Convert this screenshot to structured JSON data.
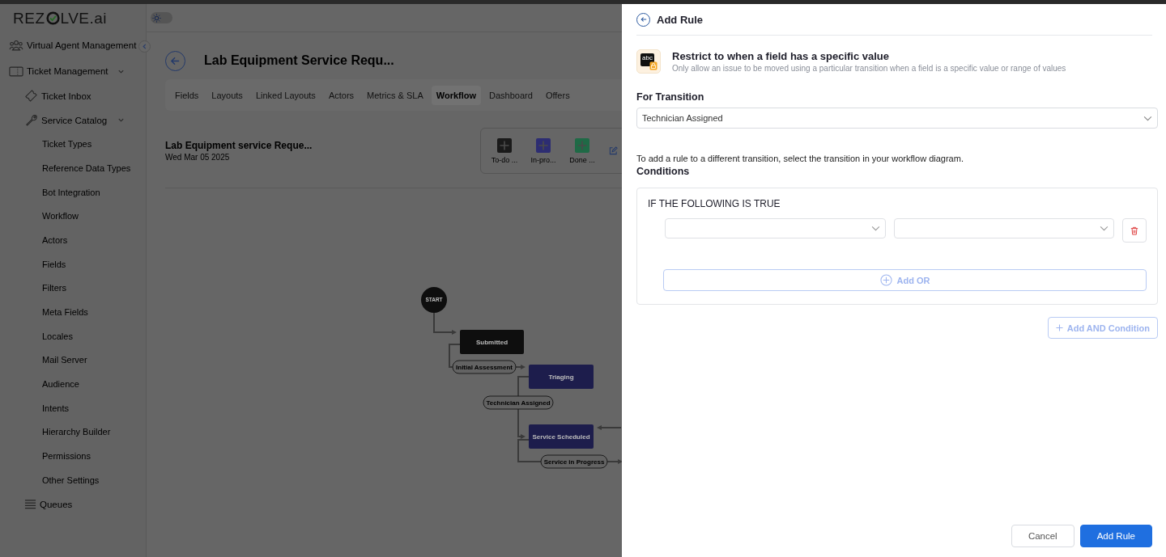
{
  "logo": {
    "start": "REZ",
    "end": "LVE.ai"
  },
  "sidebar": {
    "items": [
      {
        "label": "Virtual Agent Management"
      },
      {
        "label": "Ticket Management",
        "expanded": true,
        "children": [
          {
            "label": "Ticket Inbox"
          },
          {
            "label": "Service Catalog",
            "expanded": true,
            "children": [
              {
                "label": "Ticket Types"
              },
              {
                "label": "Reference Data Types"
              },
              {
                "label": "Bot Integration"
              },
              {
                "label": "Workflow"
              },
              {
                "label": "Actors"
              },
              {
                "label": "Fields"
              },
              {
                "label": "Filters"
              },
              {
                "label": "Meta Fields"
              },
              {
                "label": "Locales"
              },
              {
                "label": "Mail Server"
              },
              {
                "label": "Audience"
              },
              {
                "label": "Intents"
              },
              {
                "label": "Hierarchy Builder"
              },
              {
                "label": "Permissions"
              },
              {
                "label": "Other Settings"
              }
            ]
          },
          {
            "label": "Queues"
          }
        ]
      }
    ]
  },
  "theme_toggle": {
    "on": false
  },
  "page": {
    "title": "Lab Equipment Service Requ...",
    "tabs": [
      {
        "label": "Fields",
        "selected": false
      },
      {
        "label": "Layouts",
        "selected": false
      },
      {
        "label": "Linked Layouts",
        "selected": false
      },
      {
        "label": "Actors",
        "selected": false
      },
      {
        "label": "Metrics & SLA",
        "selected": false
      },
      {
        "label": "Workflow",
        "selected": true
      },
      {
        "label": "Dashboard",
        "selected": false
      },
      {
        "label": "Offers",
        "selected": false
      }
    ],
    "workflow": {
      "title": "Lab Equipment service Reque...",
      "date": "Wed Mar 05 2025",
      "status_buttons": [
        {
          "label": "To-do ...",
          "color": "#1a1a1a"
        },
        {
          "label": "In-pro...",
          "color": "#2d2d72"
        },
        {
          "label": "Done ...",
          "color": "#1f6a46"
        }
      ],
      "nodes": [
        {
          "kind": "start",
          "label": "START"
        },
        {
          "kind": "status",
          "label": "Submitted",
          "color": "#0e0e0e"
        },
        {
          "kind": "status",
          "label": "Triaging",
          "color": "#1d1d4c"
        },
        {
          "kind": "status",
          "label": "Service Scheduled",
          "color": "#1d1d4c"
        }
      ],
      "transitions": [
        "Initial Assessment",
        "Technician Assigned",
        "Service in Progress"
      ]
    }
  },
  "panel": {
    "title": "Add Rule",
    "rule_title": "Restrict to when a field has a specific value",
    "rule_description": "Only allow an issue to be moved using a particular transition when a field is a specific value or range of values",
    "icon_text": "abc",
    "transition_label": "For Transition",
    "transition_value": "Technician Assigned",
    "hint": "To add a rule to a different transition, select the transition in your workflow diagram.",
    "conditions_label": "Conditions",
    "group_heading": "IF THE FOLLOWING IS TRUE",
    "add_or": "Add OR",
    "add_and": "Add AND Condition",
    "buttons": [
      {
        "kind": "secondary",
        "label": "Cancel"
      },
      {
        "kind": "primary",
        "label": "Add Rule"
      }
    ]
  }
}
